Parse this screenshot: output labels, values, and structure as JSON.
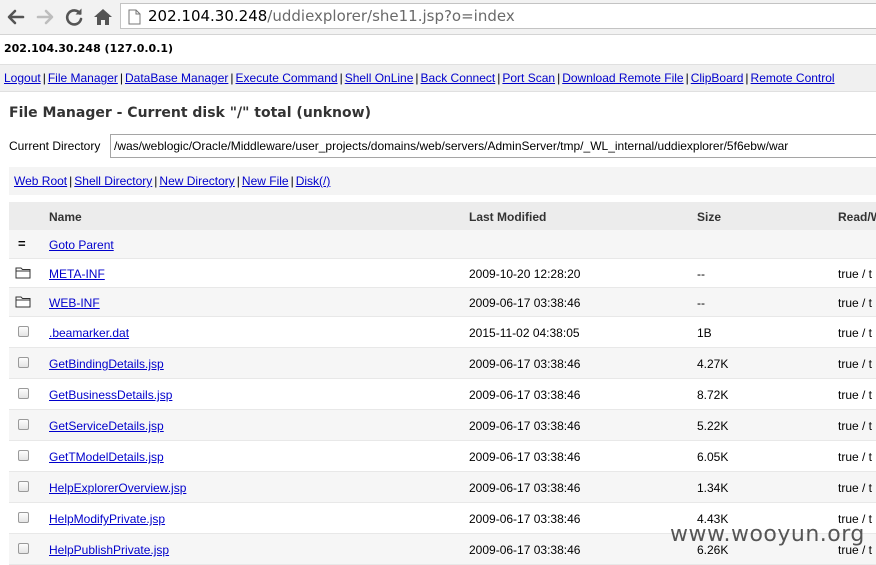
{
  "browser": {
    "url_host": "202.104.30.248",
    "url_path": "/uddiexplorer/she11.jsp?o=index"
  },
  "host_info": "202.104.30.248 (127.0.0.1)",
  "menu": [
    "Logout",
    "File Manager",
    "DataBase Manager",
    "Execute Command",
    "Shell OnLine",
    "Back Connect",
    "Port Scan",
    "Download Remote File",
    "ClipBoard",
    "Remote Control"
  ],
  "file_manager": {
    "title": "File Manager - Current disk \"/\" total (unknow)",
    "current_directory_label": "Current Directory",
    "current_directory_value": "/was/weblogic/Oracle/Middleware/user_projects/domains/web/servers/AdminServer/tmp/_WL_internal/uddiexplorer/5f6ebw/war",
    "subnav": [
      "Web Root",
      "Shell Directory",
      "New Directory",
      "New File",
      "Disk(/)"
    ],
    "columns": [
      "Name",
      "Last Modified",
      "Size",
      "Read/W"
    ],
    "parent": {
      "icon": "equals-icon",
      "label": "Goto Parent"
    },
    "entries": [
      {
        "type": "dir",
        "name": "META-INF",
        "modified": "2009-10-20 12:28:20",
        "size": "--",
        "rw": "true / t"
      },
      {
        "type": "dir",
        "name": "WEB-INF",
        "modified": "2009-06-17 03:38:46",
        "size": "--",
        "rw": "true / t"
      },
      {
        "type": "file",
        "name": ".beamarker.dat",
        "modified": "2015-11-02 04:38:05",
        "size": "1B",
        "rw": "true / t"
      },
      {
        "type": "file",
        "name": "GetBindingDetails.jsp",
        "modified": "2009-06-17 03:38:46",
        "size": "4.27K",
        "rw": "true / t"
      },
      {
        "type": "file",
        "name": "GetBusinessDetails.jsp",
        "modified": "2009-06-17 03:38:46",
        "size": "8.72K",
        "rw": "true / t"
      },
      {
        "type": "file",
        "name": "GetServiceDetails.jsp",
        "modified": "2009-06-17 03:38:46",
        "size": "5.22K",
        "rw": "true / t"
      },
      {
        "type": "file",
        "name": "GetTModelDetails.jsp",
        "modified": "2009-06-17 03:38:46",
        "size": "6.05K",
        "rw": "true / t"
      },
      {
        "type": "file",
        "name": "HelpExplorerOverview.jsp",
        "modified": "2009-06-17 03:38:46",
        "size": "1.34K",
        "rw": "true / t"
      },
      {
        "type": "file",
        "name": "HelpModifyPrivate.jsp",
        "modified": "2009-06-17 03:38:46",
        "size": "4.43K",
        "rw": "true / t"
      },
      {
        "type": "file",
        "name": "HelpPublishPrivate.jsp",
        "modified": "2009-06-17 03:38:46",
        "size": "6.26K",
        "rw": "true / t"
      }
    ]
  },
  "watermark": "www.wooyun.org"
}
